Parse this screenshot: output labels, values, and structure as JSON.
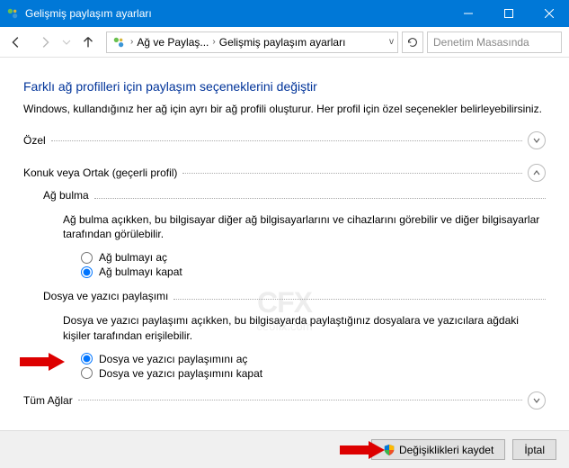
{
  "window": {
    "title": "Gelişmiş paylaşım ayarları"
  },
  "toolbar": {
    "breadcrumb": {
      "part1": "Ağ ve Paylaş...",
      "part2": "Gelişmiş paylaşım ayarları"
    },
    "search_placeholder": "Denetim Masasında"
  },
  "content": {
    "heading": "Farklı ağ profilleri için paylaşım seçeneklerini değiştir",
    "subtext": "Windows, kullandığınız her ağ için ayrı bir ağ profili oluşturur. Her profil için özel seçenekler belirleyebilirsiniz."
  },
  "sections": {
    "private": {
      "label": "Özel"
    },
    "guest": {
      "label": "Konuk veya Ortak (geçerli profil)",
      "network_discovery": {
        "title": "Ağ bulma",
        "desc": "Ağ bulma açıkken, bu bilgisayar diğer ağ bilgisayarlarını ve cihazlarını görebilir ve diğer bilgisayarlar tarafından görülebilir.",
        "on": "Ağ bulmayı aç",
        "off": "Ağ bulmayı kapat"
      },
      "file_printer": {
        "title": "Dosya ve yazıcı paylaşımı",
        "desc": "Dosya ve yazıcı paylaşımı açıkken, bu bilgisayarda paylaştığınız dosyalara ve yazıcılara ağdaki kişiler tarafından erişilebilir.",
        "on": "Dosya ve yazıcı paylaşımını aç",
        "off": "Dosya ve yazıcı paylaşımını kapat"
      }
    },
    "all": {
      "label": "Tüm Ağlar"
    }
  },
  "footer": {
    "save": "Değişiklikleri kaydet",
    "cancel": "İptal"
  },
  "watermark": {
    "big": "CFX",
    "small": "ceofix.com"
  }
}
